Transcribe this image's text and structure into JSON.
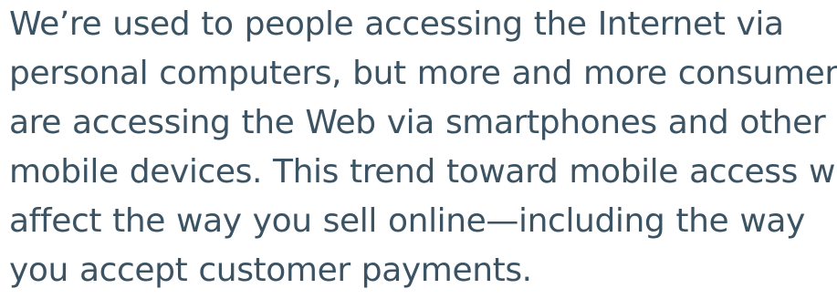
{
  "document": {
    "text_color": "#3b5363",
    "lines": [
      "We’re used to people accessing the Internet via",
      "personal computers, but more and more consumers",
      "are accessing the Web via smartphones and other",
      "mobile devices. This trend toward mobile access will",
      "affect the way you sell online—including the way",
      "you accept customer payments."
    ]
  }
}
